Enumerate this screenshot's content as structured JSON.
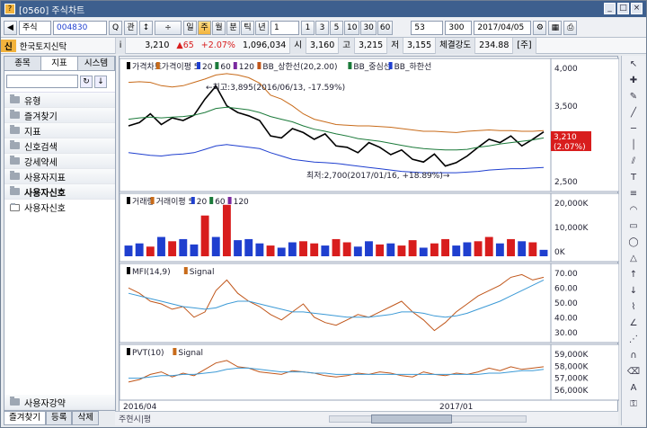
{
  "window": {
    "title": "[0560] 주식차트",
    "icon_label": "?"
  },
  "toolbar": {
    "market": "주식",
    "code": "004830",
    "period_buttons": [
      "일",
      "주",
      "월",
      "분",
      "틱",
      "년"
    ],
    "active_period": "주",
    "period_value": "1",
    "interval_buttons": [
      "1",
      "3",
      "5",
      "10",
      "30",
      "60"
    ],
    "count_value": "53",
    "total_value": "300",
    "date": "2017/04/05",
    "search_label": "Q",
    "gwan_label": "관"
  },
  "quote": {
    "badge": "신",
    "name": "한국토지신탁",
    "price": "3,210",
    "change": "▲65",
    "change_pct": "+2.07%",
    "volume": "1,096,034",
    "open_label": "시",
    "open": "3,160",
    "high_label": "고",
    "high": "3,215",
    "low_label": "저",
    "low": "3,155",
    "strength_label": "체결강도",
    "strength": "234.88",
    "unit_label": "[주]"
  },
  "sidebar": {
    "tabs": [
      "종목",
      "지표",
      "시스템"
    ],
    "active_tab": "지표",
    "items": [
      "유형",
      "즐겨찾기",
      "지표",
      "신호검색",
      "강세약세",
      "사용자지표",
      "사용자신호"
    ],
    "sub_item": "사용자신호",
    "footer_item": "사용자강약"
  },
  "bottom_tabs": [
    "즐겨찾기",
    "등록",
    "삭제"
  ],
  "scroll": {
    "label": "주현시|평"
  },
  "panels": {
    "price": {
      "legend": [
        "가격차트",
        "가격이평 5",
        "20",
        "60",
        "120",
        "BB_상한선(20,2.00)",
        "BB_중심선",
        "BB_하한선"
      ],
      "annot_high": "←최고:3,895(2016/06/13, -17.59%)",
      "annot_low": "최저:2,700(2017/01/16, +18.89%)→",
      "yticks": [
        "4,000",
        "3,500",
        "3,000",
        "2,500"
      ],
      "current": "3,210",
      "current_pct": "(2.07%)"
    },
    "volume": {
      "legend": [
        "거래량",
        "거래이평 5",
        "20",
        "60",
        "120"
      ],
      "yticks": [
        "20,000K",
        "10,000K",
        "0K"
      ]
    },
    "mfi": {
      "legend": [
        "MFI(14,9)",
        "Signal"
      ],
      "yticks": [
        "70.00",
        "60.00",
        "50.00",
        "40.00",
        "30.00"
      ]
    },
    "pvt": {
      "legend": [
        "PVT(10)",
        "Signal"
      ],
      "yticks": [
        "59,000K",
        "58,000K",
        "57,000K",
        "56,000K"
      ]
    },
    "xaxis": [
      "2016/04",
      "2017/01"
    ]
  },
  "colors": {
    "up": "#d81d1d",
    "down": "#1f3fcf",
    "title_bar": "#3d5f8e",
    "price_line": "#d81d1d"
  },
  "chart_data": [
    {
      "type": "line",
      "title": "가격차트",
      "x_labels": [
        "2016/04",
        "2017/01"
      ],
      "series": [
        {
          "name": "가격차트",
          "values": [
            3300,
            3350,
            3480,
            3320,
            3420,
            3380,
            3460,
            3700,
            3895,
            3600,
            3500,
            3450,
            3380,
            3150,
            3120,
            3260,
            3200,
            3100,
            3180,
            3000,
            2980,
            2900,
            3050,
            2980,
            2870,
            2940,
            2800,
            2760,
            2880,
            2700,
            2750,
            2850,
            2980,
            3100,
            3050,
            3150,
            3000,
            3100,
            3210
          ]
        },
        {
          "name": "BB_상한선(20,2.00)",
          "values": [
            3950,
            3960,
            3950,
            3900,
            3880,
            3900,
            3950,
            4000,
            4060,
            4080,
            4060,
            4020,
            3940,
            3760,
            3700,
            3600,
            3480,
            3400,
            3360,
            3320,
            3310,
            3300,
            3300,
            3290,
            3280,
            3260,
            3240,
            3220,
            3220,
            3210,
            3200,
            3220,
            3230,
            3240,
            3230,
            3230,
            3220,
            3220,
            3230
          ]
        },
        {
          "name": "BB_중심선",
          "values": [
            3400,
            3420,
            3430,
            3420,
            3430,
            3440,
            3460,
            3500,
            3560,
            3580,
            3560,
            3540,
            3500,
            3440,
            3400,
            3360,
            3300,
            3250,
            3220,
            3180,
            3150,
            3110,
            3090,
            3070,
            3040,
            3010,
            2980,
            2960,
            2950,
            2940,
            2940,
            2950,
            2980,
            3000,
            3030,
            3050,
            3070,
            3090,
            3120
          ]
        },
        {
          "name": "BB_하한선",
          "values": [
            2900,
            2880,
            2860,
            2850,
            2870,
            2880,
            2900,
            2950,
            3000,
            3020,
            3000,
            2980,
            2960,
            2900,
            2850,
            2800,
            2780,
            2760,
            2750,
            2740,
            2720,
            2700,
            2680,
            2660,
            2640,
            2620,
            2610,
            2600,
            2600,
            2600,
            2600,
            2610,
            2620,
            2640,
            2650,
            2660,
            2660,
            2670,
            2680
          ]
        }
      ],
      "ylim": [
        2400,
        4200
      ]
    },
    {
      "type": "bar",
      "title": "거래량",
      "values": [
        5000,
        6000,
        4500,
        9000,
        7000,
        8000,
        5500,
        19000,
        9000,
        24000,
        7500,
        8000,
        6000,
        5000,
        4000,
        6500,
        7000,
        6000,
        5000,
        8000,
        6500,
        4500,
        7000,
        5500,
        6000,
        5000,
        7500,
        4000,
        6000,
        8000,
        5000,
        6500,
        7000,
        9000,
        6000,
        8000,
        7000,
        6500,
        3000
      ],
      "directions": [
        "d",
        "d",
        "u",
        "d",
        "u",
        "d",
        "d",
        "u",
        "d",
        "u",
        "d",
        "d",
        "d",
        "u",
        "d",
        "d",
        "u",
        "u",
        "d",
        "u",
        "u",
        "d",
        "d",
        "u",
        "d",
        "u",
        "u",
        "d",
        "u",
        "u",
        "d",
        "d",
        "u",
        "u",
        "d",
        "u",
        "d",
        "u",
        "d"
      ],
      "ylim": [
        0,
        26000
      ]
    },
    {
      "type": "line",
      "title": "MFI(14,9)",
      "series": [
        {
          "name": "MFI(14,9)",
          "values": [
            62,
            58,
            52,
            50,
            46,
            48,
            40,
            44,
            60,
            68,
            58,
            52,
            48,
            42,
            38,
            44,
            50,
            40,
            36,
            34,
            38,
            42,
            40,
            44,
            48,
            52,
            44,
            38,
            30,
            36,
            44,
            50,
            56,
            60,
            64,
            70,
            72,
            68,
            70
          ]
        },
        {
          "name": "Signal",
          "values": [
            58,
            56,
            54,
            52,
            50,
            48,
            47,
            46,
            47,
            50,
            52,
            52,
            50,
            48,
            46,
            44,
            44,
            43,
            42,
            41,
            40,
            40,
            40,
            41,
            42,
            44,
            44,
            43,
            41,
            40,
            41,
            43,
            46,
            49,
            52,
            56,
            60,
            64,
            68
          ]
        }
      ],
      "ylim": [
        25,
        75
      ]
    },
    {
      "type": "line",
      "title": "PVT(10)",
      "series": [
        {
          "name": "PVT(10)",
          "values": [
            56800,
            57000,
            57400,
            57600,
            57200,
            57500,
            57300,
            57800,
            58300,
            58500,
            58000,
            57900,
            57600,
            57500,
            57400,
            57700,
            57600,
            57500,
            57300,
            57200,
            57300,
            57500,
            57400,
            57600,
            57500,
            57300,
            57200,
            57600,
            57400,
            57300,
            57500,
            57400,
            57600,
            57900,
            57700,
            58000,
            57800,
            57900,
            58000
          ]
        },
        {
          "name": "Signal",
          "values": [
            57100,
            57100,
            57200,
            57300,
            57300,
            57400,
            57400,
            57500,
            57600,
            57800,
            57900,
            57900,
            57800,
            57700,
            57600,
            57600,
            57600,
            57500,
            57500,
            57400,
            57400,
            57400,
            57400,
            57400,
            57400,
            57400,
            57400,
            57400,
            57400,
            57400,
            57400,
            57400,
            57400,
            57500,
            57500,
            57600,
            57700,
            57700,
            57800
          ]
        }
      ],
      "ylim": [
        55800,
        59200
      ]
    }
  ]
}
